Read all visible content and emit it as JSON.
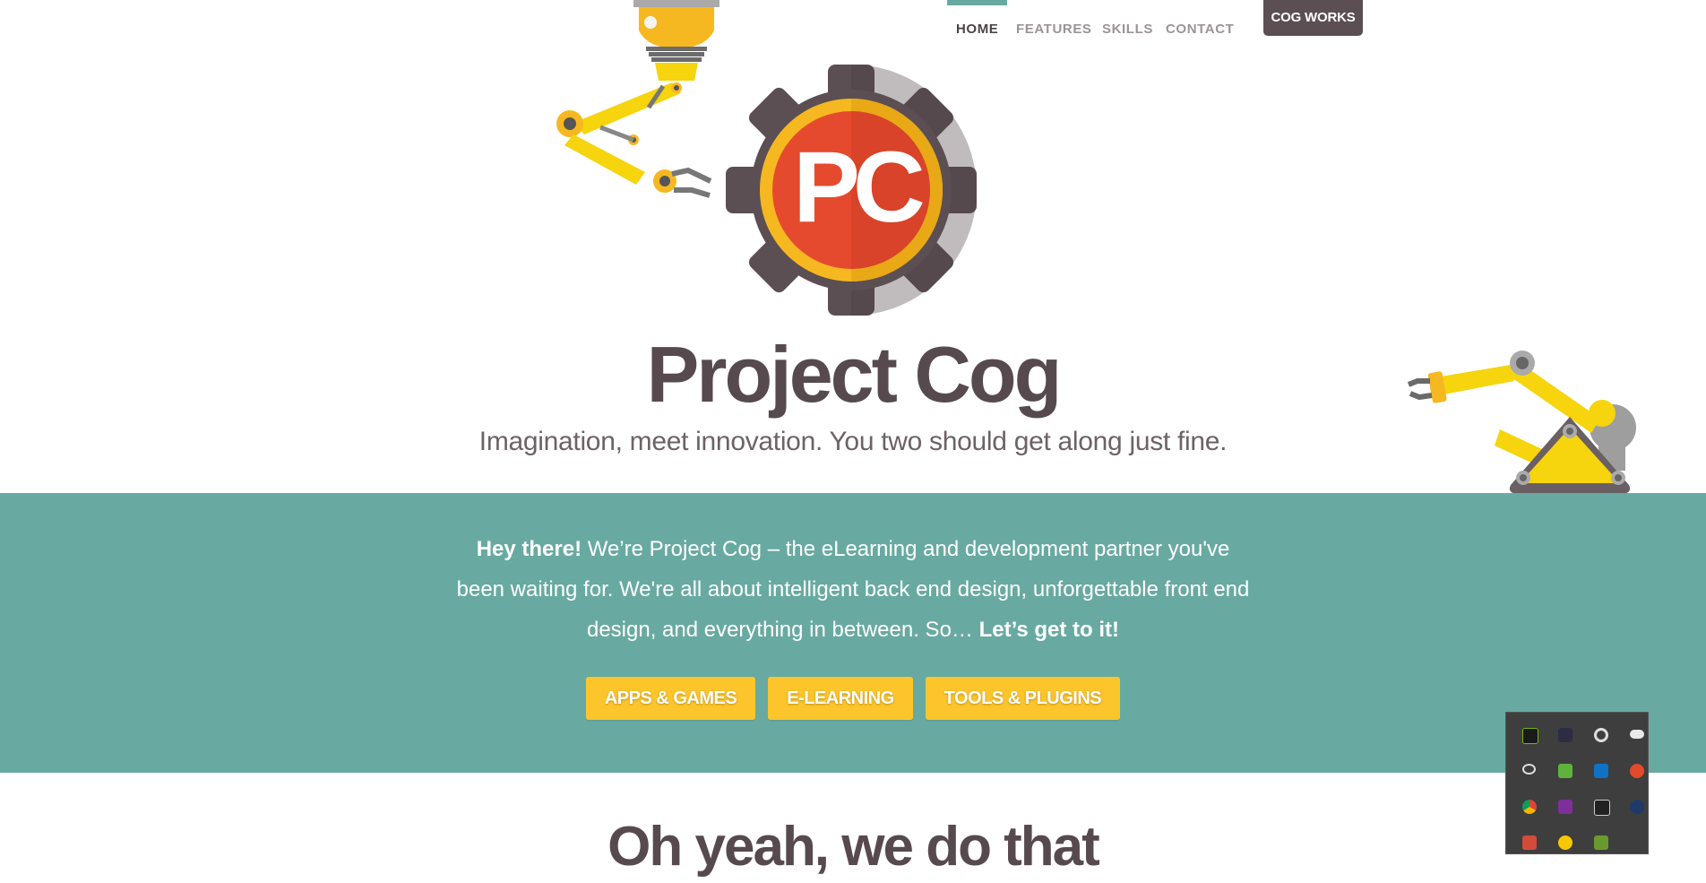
{
  "nav": {
    "items": [
      {
        "label": "HOME",
        "active": true
      },
      {
        "label": "FEATURES",
        "active": false
      },
      {
        "label": "SKILLS",
        "active": false
      },
      {
        "label": "CONTACT",
        "active": false
      }
    ],
    "cta_label": "COG WORKS"
  },
  "hero": {
    "logo_letters": "PC",
    "title": "Project Cog",
    "tagline": "Imagination, meet innovation. You two should get along just fine."
  },
  "intro": {
    "lead": "Hey there!",
    "body": " We’re Project Cog – the eLearning and development partner you've been waiting for. We're all about intelligent back end design, unforgettable front end design, and everything in between. So…",
    "closing": " Let’s get to it!"
  },
  "buttons": [
    "APPS & GAMES",
    "E-LEARNING",
    "TOOLS & PLUGINS"
  ],
  "section2": {
    "title": "Oh yeah, we do that"
  },
  "tray": {
    "icons": [
      "nvidia-icon",
      "bluetooth-icon",
      "record-icon",
      "onedrive-icon",
      "creative-cloud-icon",
      "evernote-icon",
      "outlook-icon",
      "upload-icon",
      "chrome-icon",
      "onenote-icon",
      "hp-icon",
      "steam-icon",
      "usb-eject-icon",
      "norton-icon",
      "minecraft-icon"
    ]
  },
  "colors": {
    "teal": "#68aaa1",
    "yellow": "#fcc52c",
    "cog": "#5b4f53",
    "logo_red": "#e64a2e",
    "logo_ring": "#f6b820"
  }
}
